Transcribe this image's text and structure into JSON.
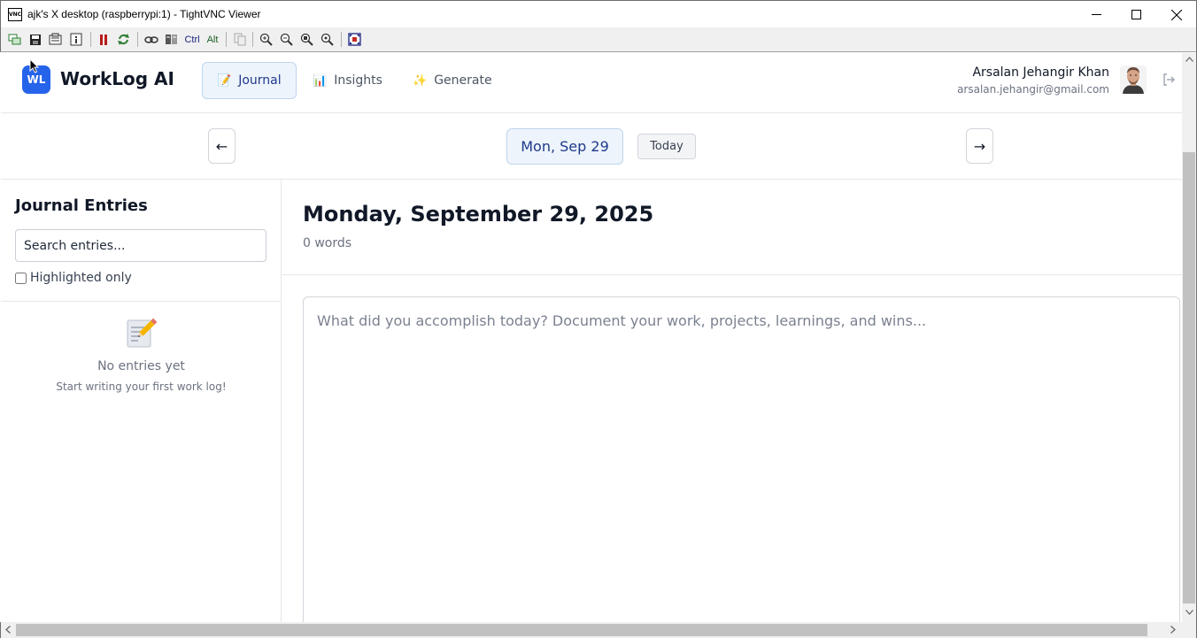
{
  "window": {
    "title": "ajk's X desktop (raspberrypi:1) - TightVNC Viewer",
    "icon_text": "VNC"
  },
  "toolbar": {
    "ctrl_label": "Ctrl",
    "alt_label": "Alt"
  },
  "app": {
    "logo_badge": "WL",
    "logo_text": "WorkLog AI",
    "tabs": [
      {
        "emoji": "📝",
        "label": "Journal",
        "active": true
      },
      {
        "emoji": "📊",
        "label": "Insights",
        "active": false
      },
      {
        "emoji": "✨",
        "label": "Generate",
        "active": false
      }
    ],
    "user": {
      "name": "Arsalan Jehangir Khan",
      "email": "arsalan.jehangir@gmail.com"
    }
  },
  "date_nav": {
    "prev_label": "←",
    "next_label": "→",
    "current_date": "Mon, Sep 29",
    "today_label": "Today"
  },
  "sidebar": {
    "title": "Journal Entries",
    "search_placeholder": "Search entries...",
    "highlighted_label": "Highlighted only",
    "highlighted_checked": false,
    "empty_icon": "📝",
    "empty_title": "No entries yet",
    "empty_subtitle": "Start writing your first work log!"
  },
  "main": {
    "entry_date": "Monday, September 29, 2025",
    "word_count": "0 words",
    "editor_placeholder": "What did you accomplish today? Document your work, projects, learnings, and wins..."
  },
  "colors": {
    "accent": "#2563eb",
    "active_tab_bg": "#eef4fc",
    "active_tab_text": "#1e3a8a"
  }
}
